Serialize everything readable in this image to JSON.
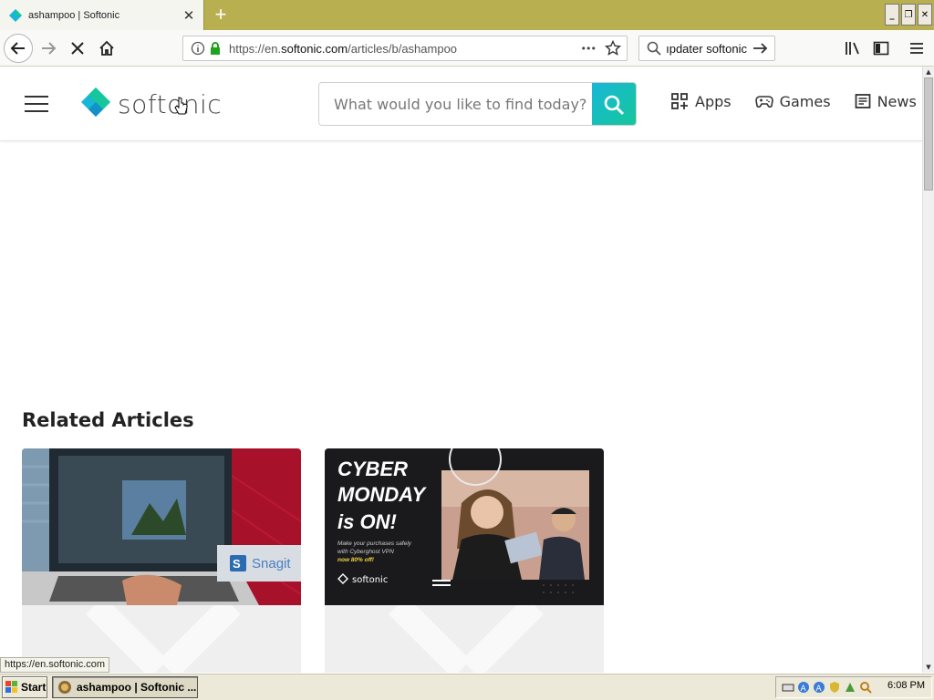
{
  "browser": {
    "tab_title": "ashampoo | Softonic",
    "tab_close": "✕",
    "new_tab": "+",
    "url_prefix": "https://en.",
    "url_host": "softonic.com",
    "url_path": "/articles/b/ashampoo",
    "url_more": "•••",
    "search_value": "ıpdater softonic",
    "window_buttons": [
      "_",
      "❐",
      "✕"
    ]
  },
  "site": {
    "logo_text": "softonic",
    "search_placeholder": "What would you like to find today?",
    "nav": [
      {
        "label": "Apps",
        "icon": "apps-grid-icon"
      },
      {
        "label": "Games",
        "icon": "gamepad-icon"
      },
      {
        "label": "News",
        "icon": "news-icon"
      }
    ],
    "brand_colors": {
      "cyan": "#19b7d6",
      "green": "#15c79a"
    }
  },
  "main": {
    "section_title": "Related Articles",
    "cards": [
      {
        "image": "snagit-laptop",
        "overlay_text": "Snagit"
      },
      {
        "image": "cyber-monday",
        "headline": [
          "CYBER",
          "MONDAY",
          "is ON!"
        ],
        "small_text": [
          "Make your purchases safely",
          "with Cyberghost VPN",
          "now 80% off!"
        ],
        "brand": "softonic"
      }
    ]
  },
  "status": {
    "hover_url": "https://en.softonic.com"
  },
  "taskbar": {
    "start_label": "Start",
    "task_label": "ashampoo | Softonic ...",
    "clock": "6:08 PM"
  }
}
